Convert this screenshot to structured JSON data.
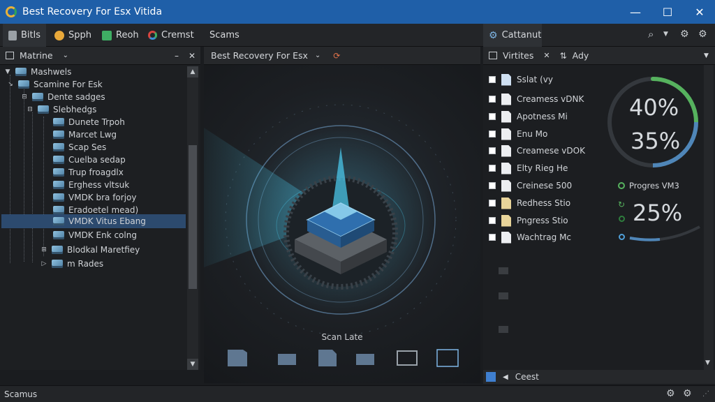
{
  "window": {
    "title": "Best Recovery For Esx Vitida",
    "minimize": "—",
    "maximize": "☐",
    "close": "✕"
  },
  "menu": {
    "tabs": [
      {
        "label": "Bitls"
      },
      {
        "label": "Spph"
      },
      {
        "label": "Reoh"
      },
      {
        "label": "Cremst"
      },
      {
        "label": "Scams"
      }
    ],
    "right_tab": "Cattanut"
  },
  "left_pane": {
    "title": "Matrine",
    "tree": [
      {
        "label": "Mashwels"
      },
      {
        "label": "Scamine For Esk"
      },
      {
        "label": "Dente sadges"
      },
      {
        "label": "Slebhedgs"
      },
      {
        "label": "Dunete Trpoh"
      },
      {
        "label": "Marcet Lwg"
      },
      {
        "label": "Scap Ses"
      },
      {
        "label": "Cuelba sedap"
      },
      {
        "label": "Trup froagdlx"
      },
      {
        "label": "Erghess vltsuk"
      },
      {
        "label": "VMDK bra forjoy"
      },
      {
        "label": "Eradoetel mead)"
      },
      {
        "label": "VMDK Vitus Ebang"
      },
      {
        "label": "VMDK Enk colng"
      },
      {
        "label": "Blodkal Maretfiey"
      },
      {
        "label": "m Rades"
      }
    ]
  },
  "center_pane": {
    "title": "Best Recovery For Esx",
    "scan_label": "Scan Late"
  },
  "right_pane": {
    "filter_label": "Virtites",
    "action_label": "Ady",
    "files": [
      {
        "name": "Sslat (vy",
        "icon": "doc-blue"
      },
      {
        "name": "Creamess vDNK",
        "icon": "doc"
      },
      {
        "name": "Apotness Mi",
        "icon": "doc"
      },
      {
        "name": "Enu Mo",
        "icon": "doc"
      },
      {
        "name": "Creamese vDOK",
        "icon": "doc"
      },
      {
        "name": "Elty Rieg He",
        "icon": "doc"
      },
      {
        "name": "Creinese 500",
        "icon": "doc"
      },
      {
        "name": "Redhess Stio",
        "icon": "doc-yellow"
      },
      {
        "name": "Pngress Stio",
        "icon": "doc-yellow"
      },
      {
        "name": "Wachtrag Mc",
        "icon": "doc"
      }
    ],
    "stats": {
      "pct1": "40%",
      "pct2": "35%",
      "progress_label": "Progres VM3",
      "pct3": "25%"
    },
    "bottom_label": "Ceest"
  },
  "status": {
    "text": "Scamus"
  },
  "colors": {
    "titlebar": "#1f5fa8",
    "accent_cyan": "#49c6e8",
    "ring_blue": "#4f86b8",
    "ring_green": "#56b25e"
  }
}
